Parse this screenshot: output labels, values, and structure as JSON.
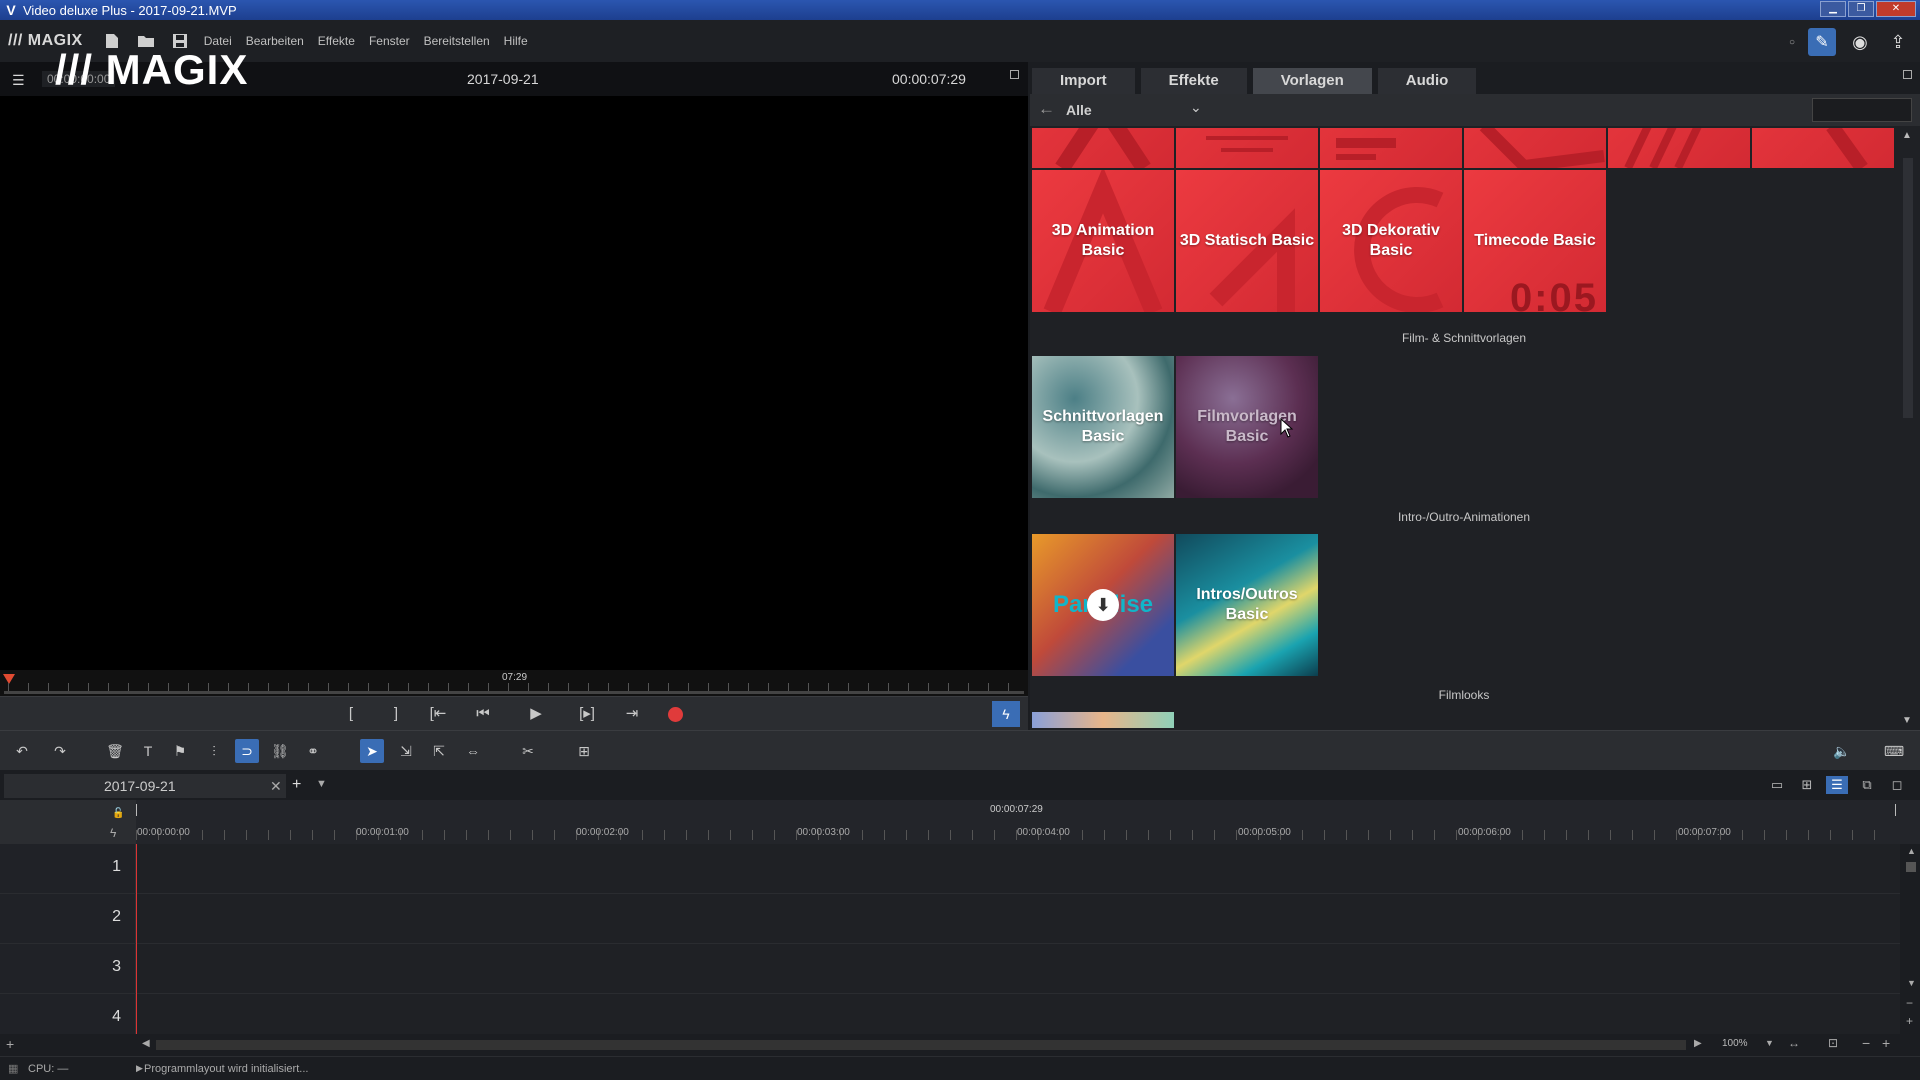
{
  "window": {
    "title": "Video deluxe Plus - 2017-09-21.MVP"
  },
  "menu": {
    "brand": "/// MAGIX",
    "items": [
      "Datei",
      "Bearbeiten",
      "Effekte",
      "Fenster",
      "Bereitstellen",
      "Hilfe"
    ]
  },
  "preview": {
    "timecode_left": "00:00:00:00",
    "logo": "/// MAGIX",
    "title": "2017-09-21",
    "timecode_right": "00:00:07:29",
    "scrub_label": "07:29"
  },
  "panel": {
    "tabs": [
      "Import",
      "Effekte",
      "Vorlagen",
      "Audio"
    ],
    "active_tab": "Vorlagen",
    "filter": "Alle",
    "search": {
      "value": "",
      "placeholder": ""
    },
    "title_tiles": [
      "3D Animation Basic",
      "3D Statisch Basic",
      "3D Dekorativ Basic",
      "Timecode Basic"
    ],
    "timecode_tile_digits": "0:05",
    "sections": [
      "Film- & Schnittvorlagen",
      "Intro-/Outro-Animationen",
      "Filmlooks"
    ],
    "film_tiles": [
      "Schnittvorlagen Basic",
      "Filmvorlagen Basic"
    ],
    "intro_tiles": [
      "Paradise",
      "Intros/Outros Basic"
    ]
  },
  "timeline": {
    "tab_label": "2017-09-21",
    "length": "00:00:07:29",
    "ruler_labels": [
      "00:00:00:00",
      "00:00:01:00",
      "00:00:02:00",
      "00:00:03:00",
      "00:00:04:00",
      "00:00:05:00",
      "00:00:06:00",
      "00:00:07:00"
    ],
    "tracks": [
      "1",
      "2",
      "3",
      "4"
    ],
    "zoom": "100%"
  },
  "status": {
    "cpu": "CPU: —",
    "message": "Programmlayout wird initialisiert..."
  },
  "colors": {
    "accent": "#3a6db5",
    "template_red": "#e3343b",
    "record": "#e03b3b"
  }
}
